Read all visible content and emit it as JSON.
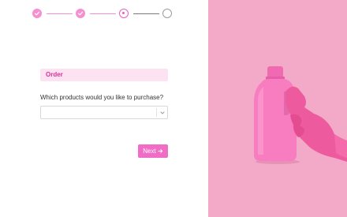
{
  "stepper": {
    "steps": [
      {
        "state": "done",
        "icon": "check-icon"
      },
      {
        "state": "done",
        "icon": "check-icon"
      },
      {
        "state": "active",
        "icon": "dot-icon"
      },
      {
        "state": "todo",
        "icon": ""
      }
    ],
    "active_color": "#ee5cbf",
    "done_color": "#f58fcf"
  },
  "form": {
    "section_title": "Order",
    "question": "Which products would you like to purchase?",
    "select_value": "",
    "next_label": "Next",
    "next_icon": "arrow-right-icon"
  },
  "colors": {
    "accent": "#f06cc5",
    "header_bg": "#fde2f2",
    "header_text": "#d6329d",
    "image_bg": "#f3aac8"
  }
}
